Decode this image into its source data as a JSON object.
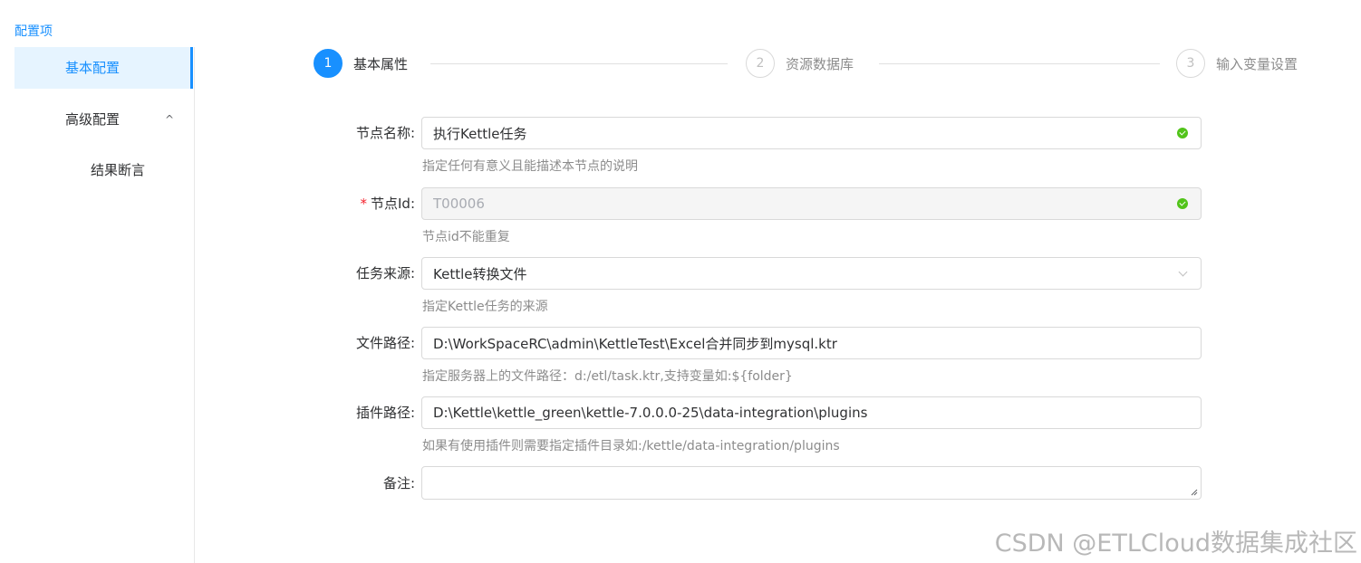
{
  "sidebar": {
    "title": "配置项",
    "items": [
      {
        "label": "基本配置"
      },
      {
        "label": "高级配置",
        "chevron": "^"
      },
      {
        "label": "结果断言"
      }
    ]
  },
  "steps": [
    {
      "number": "1",
      "label": "基本属性"
    },
    {
      "number": "2",
      "label": "资源数据库"
    },
    {
      "number": "3",
      "label": "输入变量设置"
    }
  ],
  "form": {
    "node_name": {
      "label": "节点名称:",
      "value": "执行Kettle任务",
      "help": "指定任何有意义且能描述本节点的说明"
    },
    "node_id": {
      "required_mark": "*",
      "label": "节点Id:",
      "value": "T00006",
      "help": "节点id不能重复"
    },
    "task_source": {
      "label": "任务来源:",
      "value": "Kettle转换文件",
      "help": "指定Kettle任务的来源"
    },
    "file_path": {
      "label": "文件路径:",
      "value": "D:\\WorkSpaceRC\\admin\\KettleTest\\Excel合并同步到mysql.ktr",
      "help": "指定服务器上的文件路径：d:/etl/task.ktr,支持变量如:${folder}"
    },
    "plugin_path": {
      "label": "插件路径:",
      "value": "D:\\Kettle\\kettle_green\\kettle-7.0.0.0-25\\data-integration\\plugins",
      "help": "如果有使用插件则需要指定插件目录如:/kettle/data-integration/plugins"
    },
    "remark": {
      "label": "备注:",
      "value": ""
    }
  },
  "watermark": "CSDN @ETLCloud数据集成社区",
  "colors": {
    "accent": "#1890ff",
    "success": "#52c41a",
    "required": "#f5222d"
  }
}
